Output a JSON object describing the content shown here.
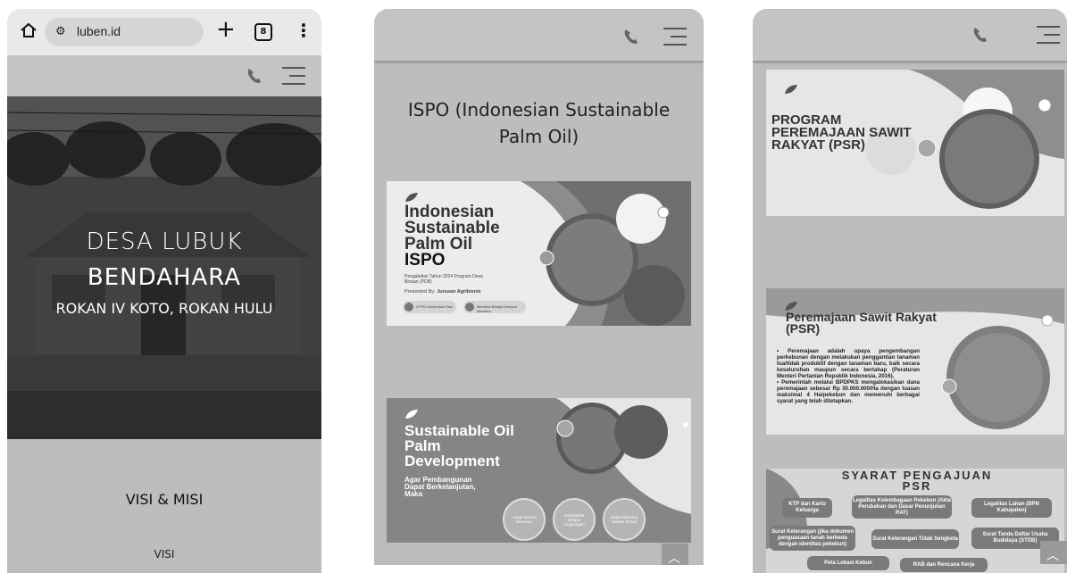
{
  "phone1": {
    "browser": {
      "url": "luben.id",
      "tab_count": "8"
    },
    "hero": {
      "title_line1": "DESA LUBUK",
      "title_line2": "BENDAHARA",
      "subtitle": "ROKAN IV KOTO, ROKAN HULU"
    },
    "section_title": "VISI & MISI",
    "subsection": "VISI"
  },
  "phone2": {
    "page_title": "ISPO (Indonesian Sustainable Palm Oil)",
    "slide1": {
      "title_lines": [
        "Indonesian",
        "Sustainable",
        "Palm Oil",
        "ISPO"
      ],
      "caption": "Pengabdian Tahun 2024 Program Desa Binaan (PDB)",
      "presented_by_label": "Presented By:",
      "presented_by_value": "Jurusan Agribisnis",
      "logo1_text": "LPPM Universitas Riau",
      "logo2_text": "Merdeka Belajar Kampus Merdeka"
    },
    "slide2": {
      "title_lines": [
        "Sustainable Oil",
        "Palm",
        "Development"
      ],
      "subtitle_lines": [
        "Agar Pembangunan",
        "Dapat Berkelanjutan,",
        "Maka"
      ],
      "circles": [
        {
          "label": "Layak Secara Ekonomi"
        },
        {
          "label": "Kompatibel dengan Lingkungan"
        },
        {
          "label": "Dapat Diterima Secara Sosial"
        }
      ]
    }
  },
  "phone3": {
    "slide1": {
      "title_lines": [
        "PROGRAM",
        "PEREMAJAAN SAWIT",
        "RAKYAT (PSR)"
      ]
    },
    "slide2": {
      "title_lines": [
        "Peremajaan Sawit Rakyat",
        "(PSR)"
      ],
      "bullet1": "Peremajaan adalah upaya pengembangan perkebunan dengan melakukan penggantian tanaman tua/tidak produktif dengan tanaman baru, baik secara keseluruhan maupun secara bertahap (Peraturan Menteri Pertanian Republik Indonesia, 2016).",
      "bullet2": "Pemerintah melalui BPDPKS mengalokasikan dana peremajaan sebesar Rp 30.000.000/Ha dengan luasan maksimal 4 Ha/pekebun dan memenuhi berbagai syarat yang telah ditetapkan."
    },
    "slide3": {
      "title_lines": [
        "SYARAT PENGAJUAN",
        "PSR"
      ],
      "items": [
        "KTP dan Kartu Keluarga",
        "Legalitas Kelembagaan Pekebun (Akta Perubahan dan Dasar Penunjukan RAT)",
        "Legalitas Lahan (BPN Kabupaten)",
        "Surat Keterangan (jika dokumen penguasaan tanah berbeda dengan identitas pekebun)",
        "Surat Keterangan Tidak Sengketa",
        "Surat Tanda Daftar Usaha Budidaya (STDB)",
        "Peta Lokasi Kebun",
        "RAB dan Rencana Kerja"
      ]
    }
  },
  "colors": {
    "page_bg": "#ffffff",
    "phone_bg": "#bdbdbd",
    "header_bg": "#c4c4c4",
    "chrome_bg": "#e9e9e9"
  }
}
